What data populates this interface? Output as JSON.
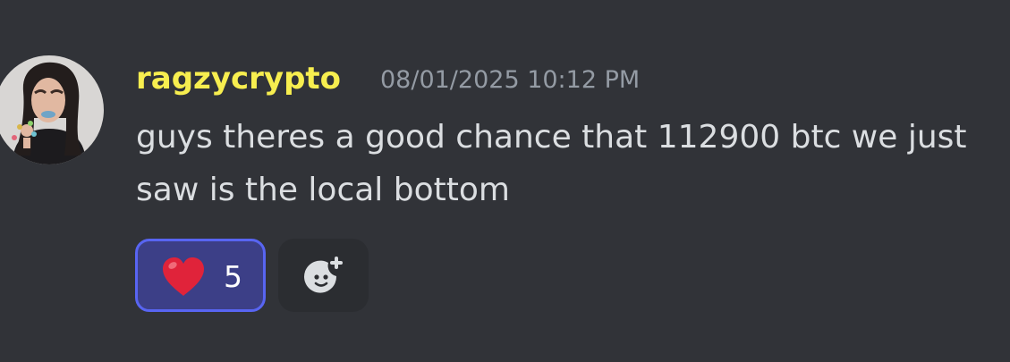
{
  "message": {
    "author": "ragzycrypto",
    "timestamp": "08/01/2025 10:12 PM",
    "content": "guys theres a good chance that 112900 btc we just saw is the local bottom",
    "author_color": "#f7ee4f"
  },
  "reactions": [
    {
      "emoji": "heart-icon",
      "count": "5",
      "active": true
    }
  ],
  "add_reaction": {
    "icon": "add-reaction-icon"
  }
}
